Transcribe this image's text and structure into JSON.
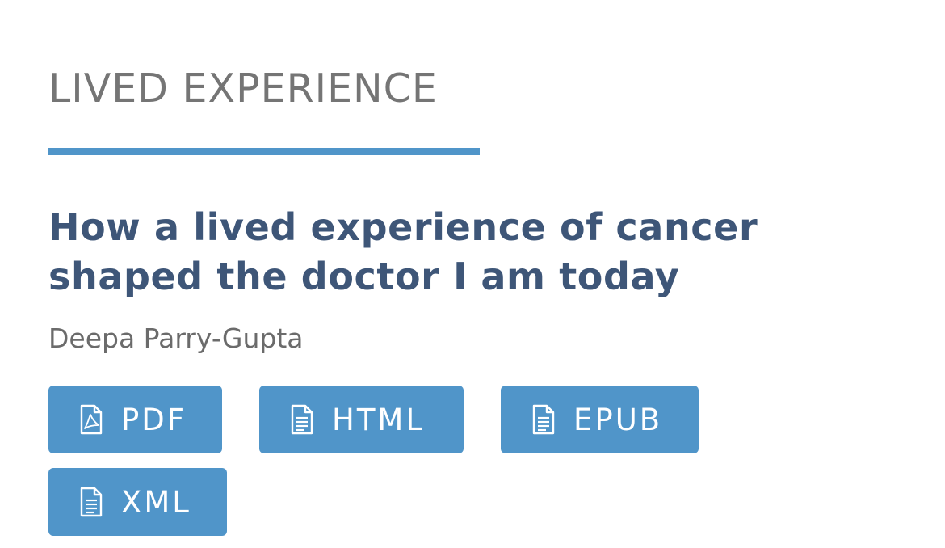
{
  "section": {
    "label": "LIVED EXPERIENCE"
  },
  "article": {
    "title": "How a lived experience of cancer shaped the doctor I am today",
    "author": "Deepa Parry-Gupta"
  },
  "downloads": [
    {
      "label": "PDF",
      "icon": "pdf-file-icon"
    },
    {
      "label": "HTML",
      "icon": "document-icon"
    },
    {
      "label": "EPUB",
      "icon": "document-icon"
    },
    {
      "label": "XML",
      "icon": "document-icon"
    }
  ],
  "colors": {
    "accent": "#5095c9",
    "title": "#3e5678",
    "label": "#757575",
    "author": "#6b6b6b",
    "button_text": "#ffffff"
  }
}
